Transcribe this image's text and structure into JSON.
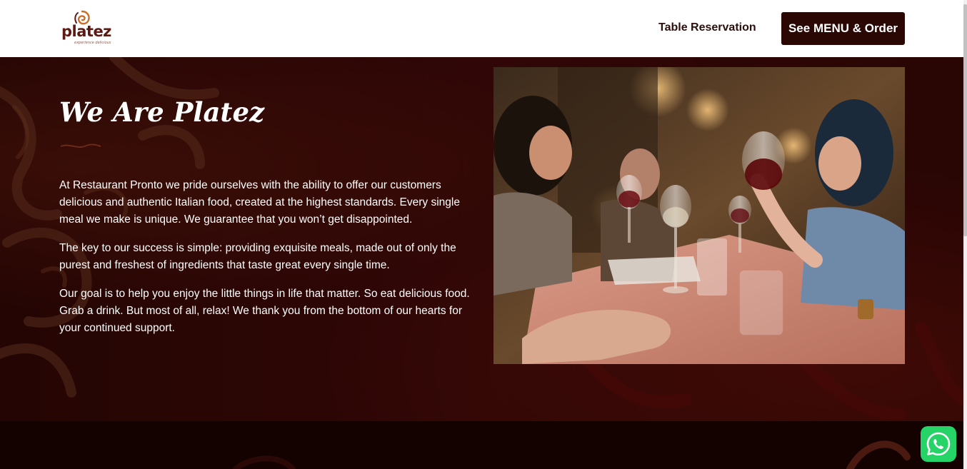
{
  "brand": {
    "name": "platez",
    "tagline": "experience delicious"
  },
  "nav": {
    "table_reservation": "Table Reservation",
    "cta": "See MENU & Order"
  },
  "hero": {
    "title": "We Are Platez",
    "paragraphs": [
      "At Restaurant Pronto we pride ourselves with the ability to offer our customers delicious and authentic Italian food, created at the highest standards. Every single meal we make is unique. We guarantee that you won’t get disappointed.",
      "The key to our success is simple: providing exquisite meals, made out of only the purest and freshest of ingredients that taste great every single time.",
      "Our goal is to help you enjoy the little things in life that matter. So eat delicious food. Grab a drink. But most of all, relax! We thank you from the bottom of our hearts for your continued support."
    ]
  },
  "colors": {
    "header_bg": "#ffffff",
    "cta_bg": "#2b0704",
    "hero_bg": "#3a0a08",
    "whatsapp": "#25d366"
  },
  "icons": {
    "whatsapp": "whatsapp-icon",
    "logo_swirl": "swirl-icon"
  }
}
